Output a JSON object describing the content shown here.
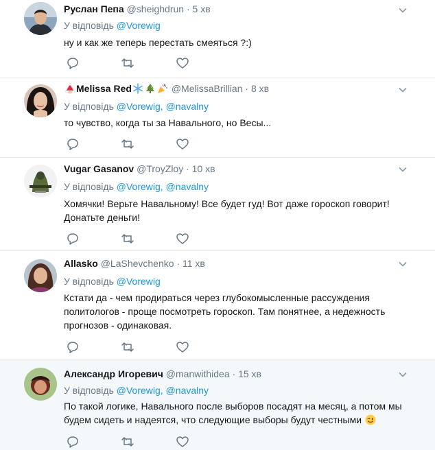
{
  "reply_prefix": "У відповідь",
  "tweets": [
    {
      "name": "Руслан Пепа",
      "handle": "@sheighdrun",
      "sep": "·",
      "time": "5 хв",
      "mentions": [
        "@Vorewig"
      ],
      "text": [
        "ну и как же теперь перестать смеяться ?:)"
      ]
    },
    {
      "name": "Melissa Red",
      "handle": "@MelissaBrillian",
      "sep": "·",
      "time": "8 хв",
      "mentions": [
        "@Vorewig,",
        "@navalny"
      ],
      "name_emojis": [
        "santa-hat-emoji",
        "snowflake-emoji",
        "christmas-tree-emoji",
        "party-popper-emoji"
      ],
      "text": [
        "то чувство, когда ты за Навального, но Весы..."
      ]
    },
    {
      "name": "Vugar Gasanov",
      "handle": "@TroyZloy",
      "sep": "·",
      "time": "10 хв",
      "mentions": [
        "@Vorewig,",
        "@navalny"
      ],
      "text": [
        "Хомячки! Верьте Навальному! Все будет гуд! Вот даже гороскоп говорит!",
        "Донатьте деньги!"
      ]
    },
    {
      "name": "Allasko",
      "handle": "@LaShevchenko",
      "sep": "·",
      "time": "11 хв",
      "mentions": [
        "@Vorewig"
      ],
      "text": [
        "Кстати да - чем продираться через глубокомысленные рассуждения",
        "политологов - проще посмотреть гороскоп. Там понятнее, а недежность",
        "прогнозов - одинаковая."
      ]
    },
    {
      "name": "Александр Игоревич",
      "handle": "@manwithidea",
      "sep": "·",
      "time": "15 хв",
      "mentions": [
        "@Vorewig,",
        "@navalny"
      ],
      "text": [
        "По такой логике, Навального после выборов посадят на месяц, а потом мы",
        "будем сидеть и надеятся, что следующие выборы будут честными"
      ],
      "text_emoji": "winking-face-emoji"
    }
  ],
  "colors": {
    "link": "#1b95e0",
    "muted": "#657786",
    "text": "#14171a",
    "border": "#e6ecf0",
    "highlight_bg": "#f5f8fa"
  }
}
